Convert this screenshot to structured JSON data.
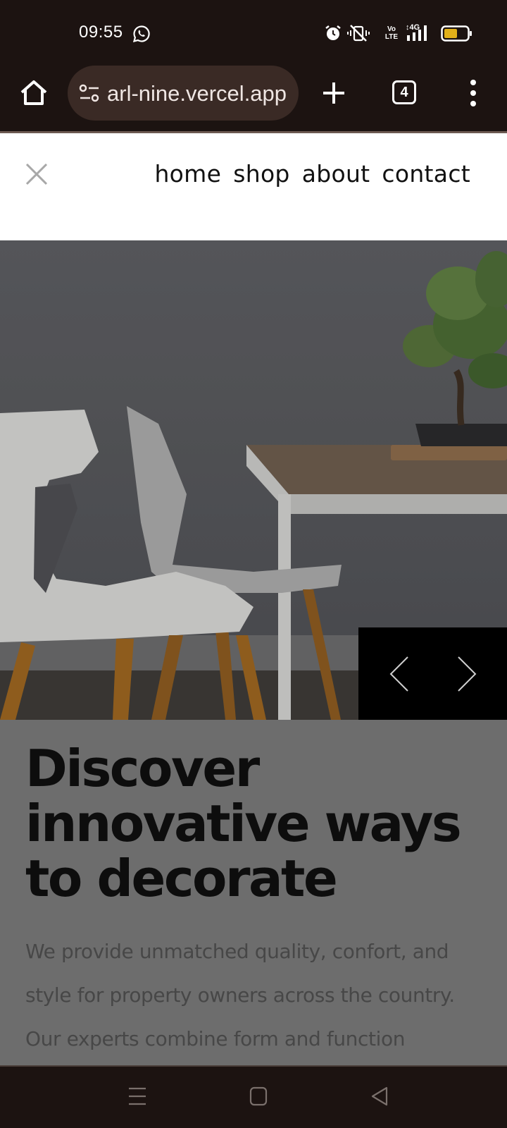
{
  "status_bar": {
    "time": "09:55",
    "icons": [
      "whatsapp-icon",
      "alarm-icon",
      "vibrate-off-icon",
      "volte-icon",
      "4g-signal-icon",
      "battery-icon"
    ],
    "volte_label": "Vo LTE",
    "network_label": "4G",
    "battery_color": "#e2b019"
  },
  "browser": {
    "url": "arl-nine.vercel.app",
    "tab_count": "4"
  },
  "site_nav": {
    "links": [
      "home",
      "shop",
      "about",
      "contact"
    ]
  },
  "hero": {
    "title": "Discover innovative ways to decorate",
    "body": "We provide unmatched quality, confort, and style for property owners across the country. Our experts combine form and function"
  },
  "colors": {
    "system_bar": "#1c1311",
    "url_pill": "#3a2a25",
    "hero_text_bg": "#6d6d6d",
    "slider_bg": "#000000"
  }
}
